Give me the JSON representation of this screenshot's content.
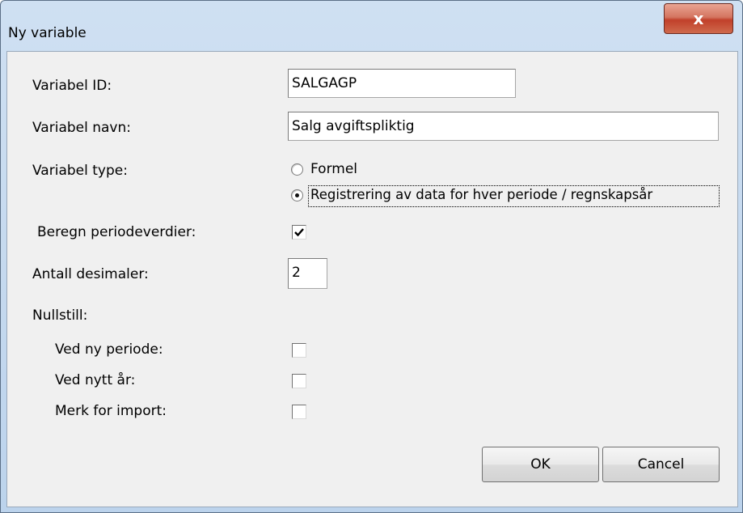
{
  "window": {
    "title": "Ny variable",
    "close_label": "x"
  },
  "form": {
    "variable_id": {
      "label": "Variabel  ID:",
      "value": "SALGAGP"
    },
    "variable_name": {
      "label": "Variabel navn:",
      "value": "Salg avgiftspliktig"
    },
    "variable_type": {
      "label": "Variabel type:",
      "options": [
        {
          "label": "Formel",
          "selected": false
        },
        {
          "label": "Registrering av data for hver periode / regnskapsår",
          "selected": true
        }
      ]
    },
    "compute_period_values": {
      "label": "Beregn periodeverdier:",
      "checked": true
    },
    "decimals": {
      "label": "Antall desimaler:",
      "value": "2"
    },
    "reset": {
      "heading": "Nullstill:",
      "new_period": {
        "label": "Ved ny periode:",
        "checked": false
      },
      "new_year": {
        "label": "Ved  nytt år:",
        "checked": false
      },
      "mark_for_import": {
        "label": "Merk for import:",
        "checked": false
      }
    }
  },
  "buttons": {
    "ok": "OK",
    "cancel": "Cancel"
  },
  "icons": {
    "close": "close-icon",
    "check": "checkmark-icon"
  }
}
